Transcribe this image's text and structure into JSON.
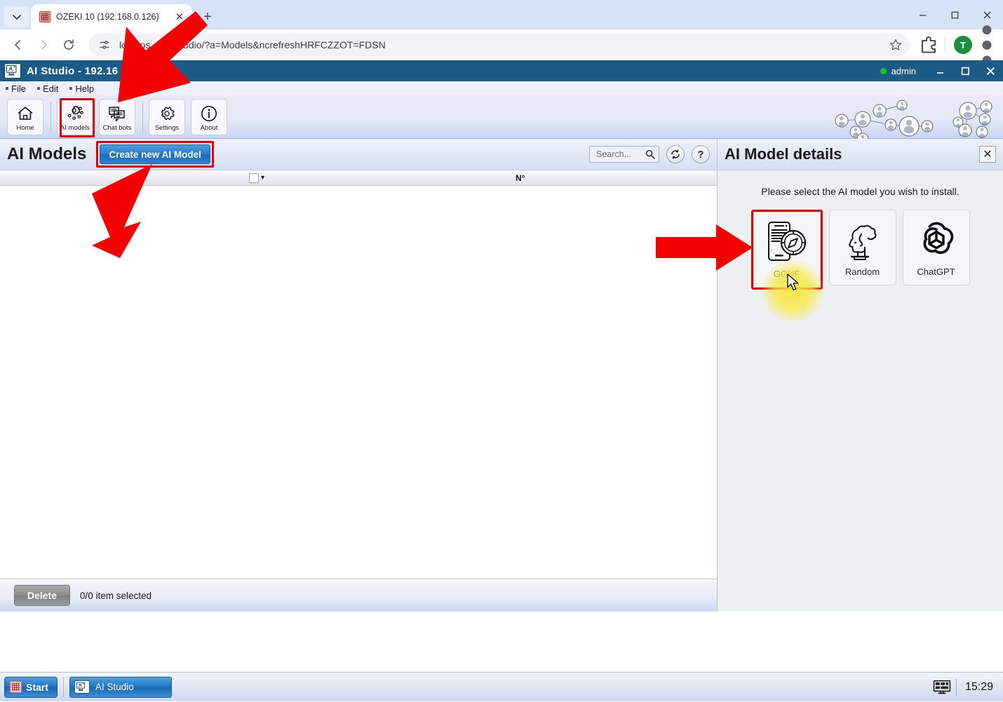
{
  "browser": {
    "tab": {
      "title": "OZEKI 10 (192.168.0.126)",
      "favicon": "ozeki-grid-icon"
    },
    "new_tab_label": "+",
    "url": "lo..lhos...........tudio/?a=Models&ncrefreshHRFCZZOT=FDSN",
    "profile_initial": "T",
    "window_controls": {
      "minimize": "minimize-icon",
      "maximize": "maximize-icon",
      "close": "close-icon"
    }
  },
  "app": {
    "title": "AI Studio - 192.16",
    "user": {
      "name": "admin",
      "status_color": "#22c32e"
    },
    "menu": [
      {
        "label": "File"
      },
      {
        "label": "Edit"
      },
      {
        "label": "Help"
      }
    ],
    "toolbar": [
      {
        "label": "Home",
        "icon": "home-icon"
      },
      {
        "label": "AI models",
        "icon": "ai-models-gear-icon",
        "selected": true
      },
      {
        "label": "Chat bots",
        "icon": "chat-bots-icon"
      },
      {
        "label": "Settings",
        "icon": "settings-gear-icon"
      },
      {
        "label": "About",
        "icon": "info-icon"
      }
    ]
  },
  "list_panel": {
    "title": "AI Models",
    "create_button": "Create new AI Model",
    "search": {
      "value": "",
      "placeholder": "Search..."
    },
    "refresh_icon": "refresh-icon",
    "help_icon": "help-icon",
    "columns": {
      "number": "N°"
    },
    "rows": [],
    "footer": {
      "delete_button": "Delete",
      "selection_status": "0/0 item selected"
    }
  },
  "details_panel": {
    "title": "AI Model details",
    "close_label": "✕",
    "prompt": "Please select the AI model you wish to install.",
    "models": [
      {
        "name": "GGUF",
        "icon": "gguf-phone-compass-icon",
        "selected": true
      },
      {
        "name": "Random",
        "icon": "random-head-cloud-icon",
        "selected": false
      },
      {
        "name": "ChatGPT",
        "icon": "chatgpt-knot-icon",
        "selected": false
      }
    ]
  },
  "taskbar": {
    "start_label": "Start",
    "tasks": [
      {
        "label": "AI Studio",
        "icon": "ai-studio-icon"
      }
    ],
    "tray_icon": "display-icon",
    "clock": "15:29"
  },
  "annotations": {
    "accent_color": "#e00000",
    "highlight_color": "#f8e83c",
    "arrows": [
      {
        "name": "arrow-to-ai-models-toolbar"
      },
      {
        "name": "arrow-to-create-new-ai-model"
      },
      {
        "name": "arrow-to-gguf-card"
      }
    ]
  }
}
